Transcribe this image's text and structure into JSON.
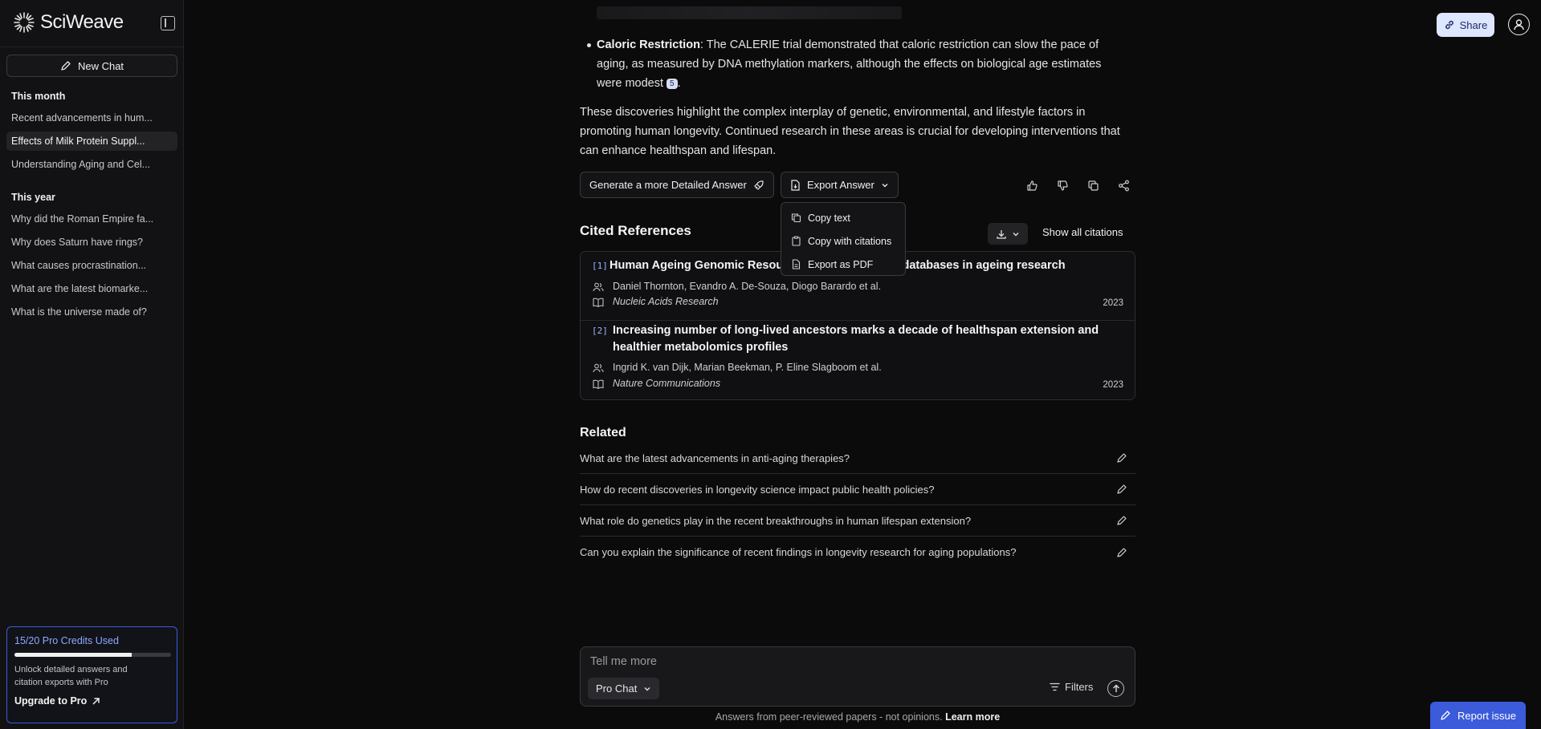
{
  "sidebar": {
    "brand": "SciWeave",
    "new_chat_label": "New Chat",
    "sections": [
      {
        "title": "This month",
        "items": [
          "Recent advancements in hum...",
          "Effects of Milk Protein Suppl...",
          "Understanding Aging and Cel..."
        ]
      },
      {
        "title": "This year",
        "items": [
          "Why did the Roman Empire fa...",
          "Why does Saturn have rings?",
          "What causes procrastination...",
          "What are the latest biomarke...",
          "What is the universe made of?"
        ]
      }
    ],
    "pro": {
      "title": "15/20 Pro Credits Used",
      "used": 15,
      "total": 20,
      "description": "Unlock detailed answers and citation exports with Pro",
      "upgrade_label": "Upgrade to Pro"
    }
  },
  "header": {
    "share_label": "Share"
  },
  "answer": {
    "bullet_title": "Caloric Restriction",
    "bullet_text": ": The CALERIE trial demonstrated that caloric restriction can slow the pace of aging, as measured by DNA methylation markers, although the effects on biological age estimates were modest",
    "bullet_cite": "5",
    "paragraph": "These discoveries highlight the complex interplay of genetic, environmental, and lifestyle factors in promoting human longevity. Continued research in these areas is crucial for developing interventions that can enhance healthspan and lifespan."
  },
  "actions": {
    "detailed_label": "Generate a more Detailed Answer",
    "export_label": "Export Answer",
    "export_menu": [
      "Copy text",
      "Copy with citations",
      "Export as PDF"
    ]
  },
  "references": {
    "title": "Cited References",
    "show_all_label": "Show all citations",
    "items": [
      {
        "num": "[1]",
        "title": "Human Ageing Genomic Resources: updates on key databases in ageing research",
        "authors": "Daniel Thornton, Evandro A. De-Souza, Diogo Barardo et al.",
        "journal": "Nucleic Acids Research",
        "year": "2023"
      },
      {
        "num": "[2]",
        "title": "Increasing number of long-lived ancestors marks a decade of healthspan extension and healthier metabolomics profiles",
        "authors": "Ingrid K. van Dijk, Marian Beekman, P. Eline Slagboom et al.",
        "journal": "Nature Communications",
        "year": "2023"
      }
    ]
  },
  "related": {
    "title": "Related",
    "items": [
      "What are the latest advancements in anti-aging therapies?",
      "How do recent discoveries in longevity science impact public health policies?",
      "What role do genetics play in the recent breakthroughs in human lifespan extension?",
      "Can you explain the significance of recent findings in longevity research for aging populations?"
    ]
  },
  "composer": {
    "placeholder": "Tell me more",
    "mode_label": "Pro Chat",
    "filters_label": "Filters"
  },
  "footer": {
    "note": "Answers from peer-reviewed papers - not opinions.",
    "learn_more": "Learn more",
    "report_label": "Report issue"
  },
  "colors": {
    "accent": "#3b5bdb",
    "pro_title": "#8ea8ff",
    "share_bg": "#dfe6ff"
  }
}
